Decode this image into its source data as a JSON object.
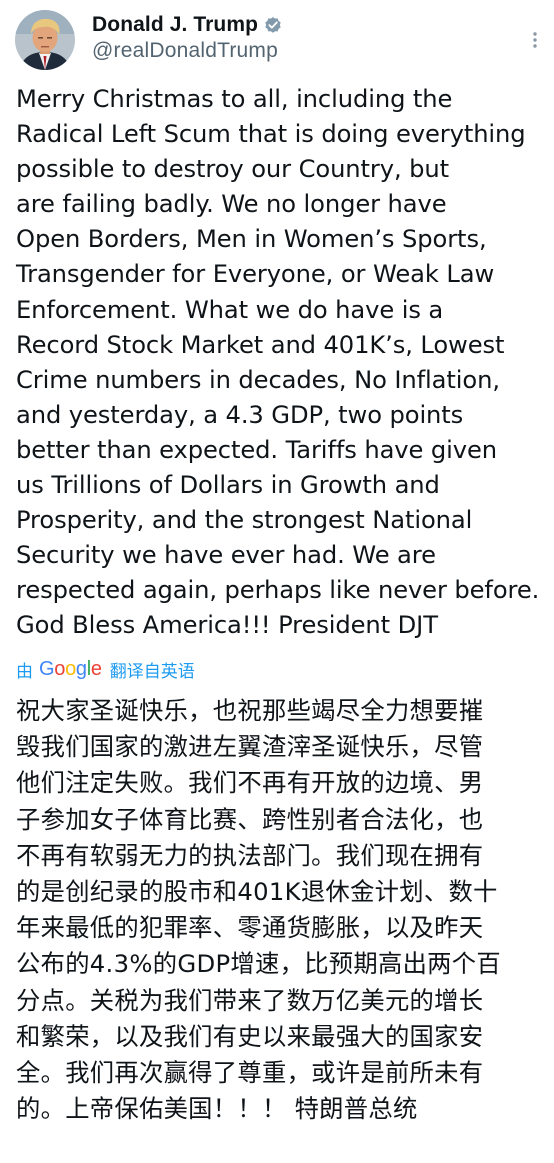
{
  "author": {
    "display_name": "Donald J. Trump",
    "handle": "@realDonaldTrump",
    "verified": true,
    "avatar_icon": "profile-photo"
  },
  "more_icon": "more-vertical-icon",
  "post": {
    "text": "Merry Christmas to all, including the\nRadical Left Scum that is doing everything\npossible to destroy our Country, but\nare failing badly. We no longer have\nOpen Borders, Men in Women’s Sports,\nTransgender for Everyone, or Weak Law\nEnforcement. What we do have is a\nRecord Stock Market and 401K’s, Lowest\nCrime numbers in decades, No Inflation,\nand yesterday, a 4.3 GDP, two points\nbetter than expected. Tariffs have given\nus Trillions of Dollars in Growth and\nProsperity, and the strongest National\nSecurity we have ever had. We are\nrespected again, perhaps like never before.\nGod Bless America!!! President DJT"
  },
  "translation": {
    "prefix": "由",
    "logo": {
      "g1": "G",
      "o1": "o",
      "o2": "o",
      "g2": "g",
      "l": "l",
      "e": "e"
    },
    "suffix": "翻译自英语",
    "text": "祝大家圣诞快乐，也祝那些竭尽全力想要摧\n毁我们国家的激进左翼渣滓圣诞快乐，尽管\n他们注定失败。我们不再有开放的边境、男\n子参加女子体育比赛、跨性别者合法化，也\n不再有软弱无力的执法部门。我们现在拥有\n的是创纪录的股市和401K退休金计划、数十\n年来最低的犯罪率、零通货膨胀，以及昨天\n公布的4.3%的GDP增速，比预期高出两个百\n分点。关税为我们带来了数万亿美元的增长\n和繁荣，以及我们有史以来最强大的国家安\n全。我们再次赢得了尊重，或许是前所未有\n的。上帝保佑美国！！！ 特朗普总统"
  },
  "colors": {
    "link": "#1d9bf0",
    "text": "#0f1419",
    "secondary": "#536471"
  }
}
